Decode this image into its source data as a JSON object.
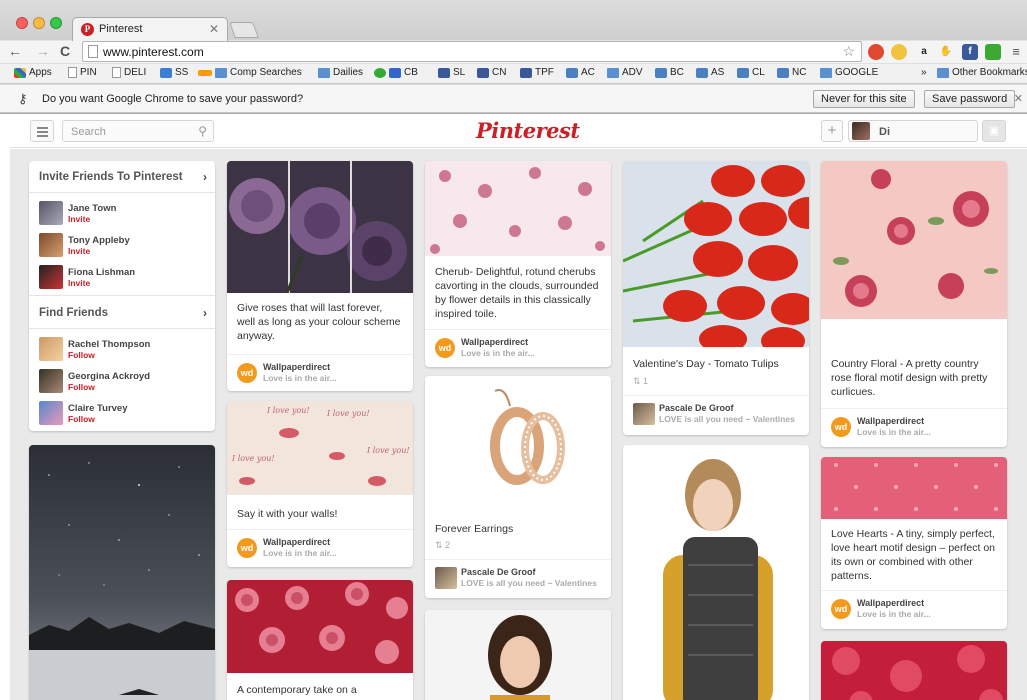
{
  "browser": {
    "tab_title": "Pinterest",
    "url": "www.pinterest.com",
    "bookmarks": [
      "Apps",
      "PIN",
      "DELI",
      "SS",
      "Comp Searches",
      "Dailies",
      "CB",
      "SL",
      "CN",
      "TPF",
      "AC",
      "ADV",
      "BC",
      "AS",
      "CL",
      "NC",
      "GOOGLE",
      "»",
      "Other Bookmarks"
    ],
    "infobar": {
      "text": "Do you want Google Chrome to save your password?",
      "never_label": "Never for this site",
      "save_label": "Save password"
    }
  },
  "header": {
    "search_placeholder": "Search",
    "logo": "Pinterest",
    "user_name": "Di"
  },
  "sidebar": {
    "invite_title": "Invite Friends To Pinterest",
    "invite_people": [
      {
        "name": "Jane Town",
        "action": "Invite"
      },
      {
        "name": "Tony Appleby",
        "action": "Invite"
      },
      {
        "name": "Fiona Lishman",
        "action": "Invite"
      }
    ],
    "find_title": "Find Friends",
    "find_people": [
      {
        "name": "Rachel Thompson",
        "action": "Follow"
      },
      {
        "name": "Georgina Ackroyd",
        "action": "Follow"
      },
      {
        "name": "Claire Turvey",
        "action": "Follow"
      }
    ]
  },
  "pins": {
    "roses": {
      "desc": "Give roses that will last forever, well as long as your colour scheme anyway.",
      "by": "Wallpaperdirect",
      "board": "Love is in the air..."
    },
    "lips": {
      "desc": "Say it with your walls!",
      "by": "Wallpaperdirect",
      "board": "Love is in the air..."
    },
    "contemporary": {
      "desc": "A contemporary take on a"
    },
    "toile": {
      "desc": "Cherub- Delightful, rotund cherubs cavorting in the clouds, surrounded by flower details in this classically inspired toile.",
      "by": "Wallpaperdirect",
      "board": "Love is in the air..."
    },
    "earrings": {
      "desc": "Forever Earrings",
      "repins": "2",
      "by": "Pascale De Groof",
      "board": "LOVE is all you need ~ Valentines"
    },
    "tulips": {
      "desc": "Valentine's Day - Tomato Tulips",
      "repins": "1",
      "by": "Pascale De Groof",
      "board": "LOVE is all you need ~ Valentines"
    },
    "country": {
      "desc": "Country Floral - A pretty country rose floral motif design with pretty curlicues.",
      "by": "Wallpaperdirect",
      "board": "Love is in the air..."
    },
    "hearts": {
      "desc": "Love Hearts - A tiny, simply perfect, love heart motif design – perfect on its own or combined with other patterns.",
      "by": "Wallpaperdirect",
      "board": "Love is in the air..."
    }
  },
  "wd_logo": "wd",
  "colors": {
    "pinterest_red": "#cb2027",
    "page_bg": "#e9e9e9"
  }
}
